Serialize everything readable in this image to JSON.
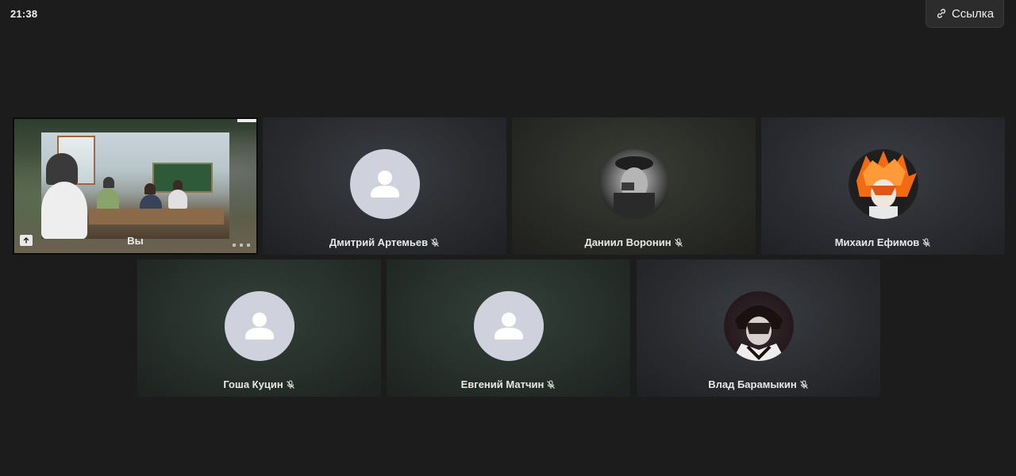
{
  "status": {
    "time": "21:38"
  },
  "toolbar": {
    "link_label": "Ссылка",
    "link_icon": "link-icon"
  },
  "participants": [
    {
      "name": "Вы",
      "self": true
    },
    {
      "name": "Дмитрий Артемьев",
      "avatar": "default-avatar",
      "muted": true
    },
    {
      "name": "Даниил Воронин",
      "avatar": "photo-avatar",
      "muted": true
    },
    {
      "name": "Михаил Ефимов",
      "avatar": "anime-avatar",
      "muted": true
    },
    {
      "name": "Гоша Куцин",
      "avatar": "default-avatar",
      "muted": true
    },
    {
      "name": "Евгений Матчин",
      "avatar": "default-avatar",
      "muted": true
    },
    {
      "name": "Влад Барамыкин",
      "avatar": "photo-avatar",
      "muted": true
    }
  ],
  "icons": {
    "mic_off": "mic-off-icon",
    "upload": "upload-icon"
  }
}
